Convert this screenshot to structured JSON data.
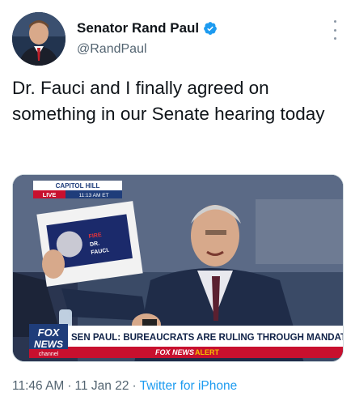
{
  "author": {
    "name": "Senator Rand Paul",
    "handle": "@RandPaul",
    "verified": true
  },
  "tweet": {
    "text": "Dr. Fauci and I finally agreed on something in our Senate hearing today"
  },
  "media": {
    "location_tag": "CAPITOL HILL",
    "live_label": "LIVE",
    "time_label": "11:13 AM ET",
    "sign_text_1": "FIRE",
    "sign_text_2": "DR.",
    "sign_text_3": "FAUCI.",
    "fox_logo_1": "FOX",
    "fox_logo_2": "NEWS",
    "fox_logo_3": "channel",
    "headline": "SEN PAUL: BUREAUCRATS ARE RULING THROUGH MANDATES",
    "alert_brand": "FOX NEWS",
    "alert_word": "ALERT"
  },
  "meta": {
    "time": "11:46 AM",
    "separator": "·",
    "date": "11 Jan 22",
    "source": "Twitter for iPhone"
  },
  "colors": {
    "verified": "#1d9bf0",
    "fox_red": "#c8102e",
    "fox_blue": "#1f3d7a",
    "link": "#1d9bf0"
  }
}
